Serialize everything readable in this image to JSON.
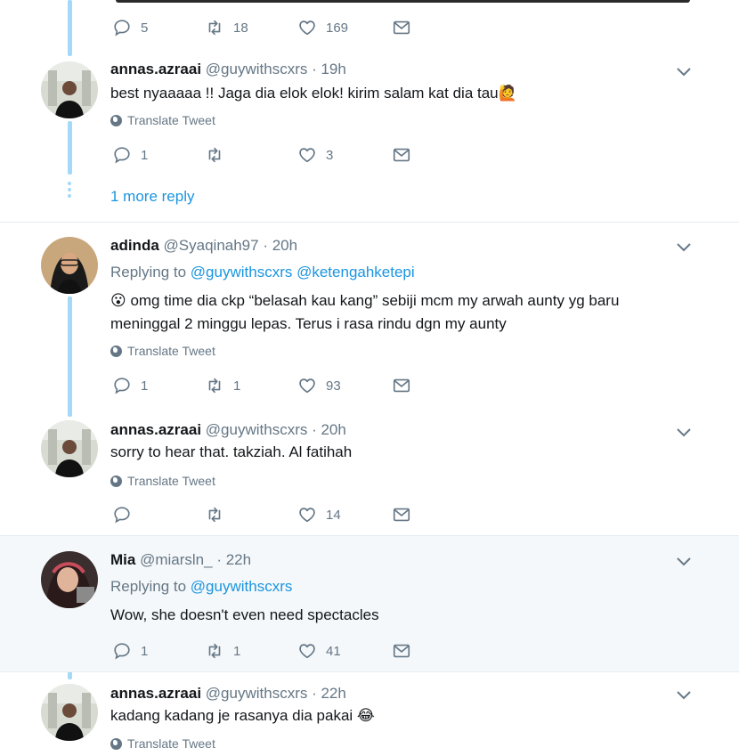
{
  "first_tweet": {
    "actions": {
      "replies": "5",
      "retweets": "18",
      "likes": "169"
    }
  },
  "tweets": [
    {
      "name": "annas.azraai",
      "handle": "@guywithscxrs",
      "time": "· 19h",
      "text_lines": [
        "best nyaaaaa !! Jaga dia elok elok! kirim salam kat dia tau🙋"
      ],
      "translate": "Translate Tweet",
      "actions": {
        "replies": "1",
        "retweets": "",
        "likes": "3"
      }
    },
    {
      "name": "adinda",
      "handle": "@Syaqinah97",
      "time": "· 20h",
      "replying_prefix": "Replying to",
      "replying_handles": [
        "@guywithscxrs",
        "@ketengahketepi"
      ],
      "text_lines": [
        "😮 omg time dia ckp “belasah kau kang” sebiji mcm my arwah aunty yg baru",
        "meninggal 2 minggu lepas. Terus i rasa rindu dgn my aunty"
      ],
      "translate": "Translate Tweet",
      "actions": {
        "replies": "1",
        "retweets": "1",
        "likes": "93"
      }
    },
    {
      "name": "annas.azraai",
      "handle": "@guywithscxrs",
      "time": "· 20h",
      "text_lines": [
        "sorry to hear that. takziah. Al fatihah"
      ],
      "translate": "Translate Tweet",
      "actions": {
        "replies": "",
        "retweets": "",
        "likes": "14"
      }
    },
    {
      "name": "Mia",
      "handle": "@miarsln_",
      "time": "· 22h",
      "replying_prefix": "Replying to",
      "replying_handles": [
        "@guywithscxrs"
      ],
      "text_lines": [
        "Wow, she doesn't even need spectacles"
      ],
      "actions": {
        "replies": "1",
        "retweets": "1",
        "likes": "41"
      }
    },
    {
      "name": "annas.azraai",
      "handle": "@guywithscxrs",
      "time": "· 22h",
      "text_lines": [
        "kadang kadang je rasanya dia pakai 😂"
      ],
      "translate": "Translate Tweet"
    }
  ],
  "more_replies": "1 more reply",
  "colors": {
    "link": "#1b95e0",
    "muted": "#657786",
    "thread": "#a4d9f7",
    "highlight": "#f5f8fa"
  }
}
